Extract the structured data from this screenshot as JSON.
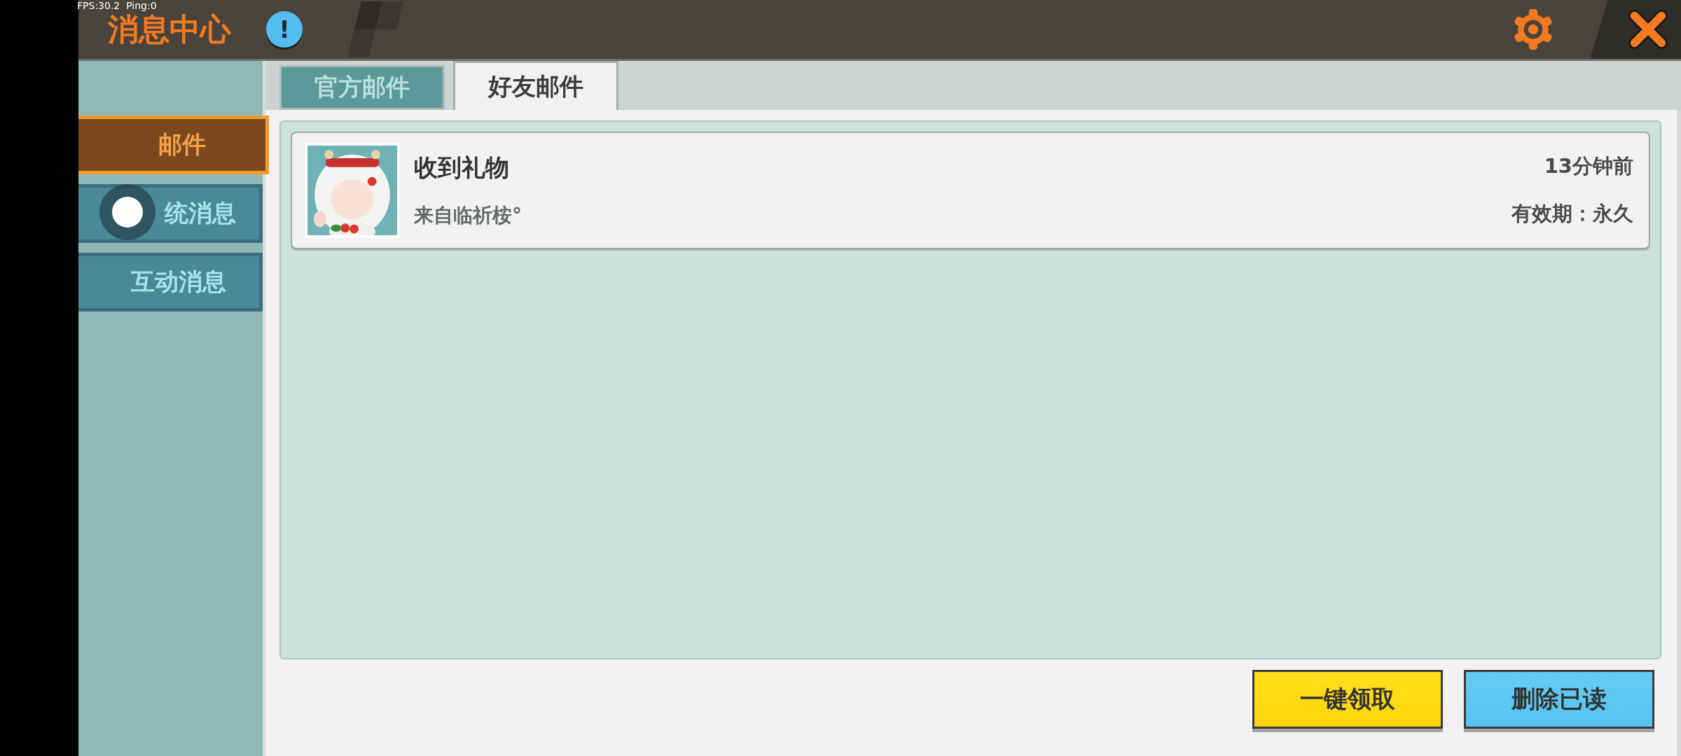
{
  "debug_overlay": "FPS:30.2  Ping:0",
  "header": {
    "title": "消息中心",
    "info_badge": "!"
  },
  "sidebar": {
    "items": [
      {
        "label": "邮件",
        "selected": true,
        "touch_marker": false
      },
      {
        "label": "统消息",
        "selected": false,
        "touch_marker": true
      },
      {
        "label": "互动消息",
        "selected": false,
        "touch_marker": false
      }
    ]
  },
  "tabs": [
    {
      "label": "官方邮件",
      "selected": false
    },
    {
      "label": "好友邮件",
      "selected": true
    }
  ],
  "mails": [
    {
      "title": "收到礼物",
      "sender": "来自临祈桉°",
      "time": "13分钟前",
      "validity": "有效期：永久"
    }
  ],
  "buttons": [
    {
      "label": "一键领取",
      "kind": "primary"
    },
    {
      "label": "删除已读",
      "kind": "secondary"
    }
  ]
}
